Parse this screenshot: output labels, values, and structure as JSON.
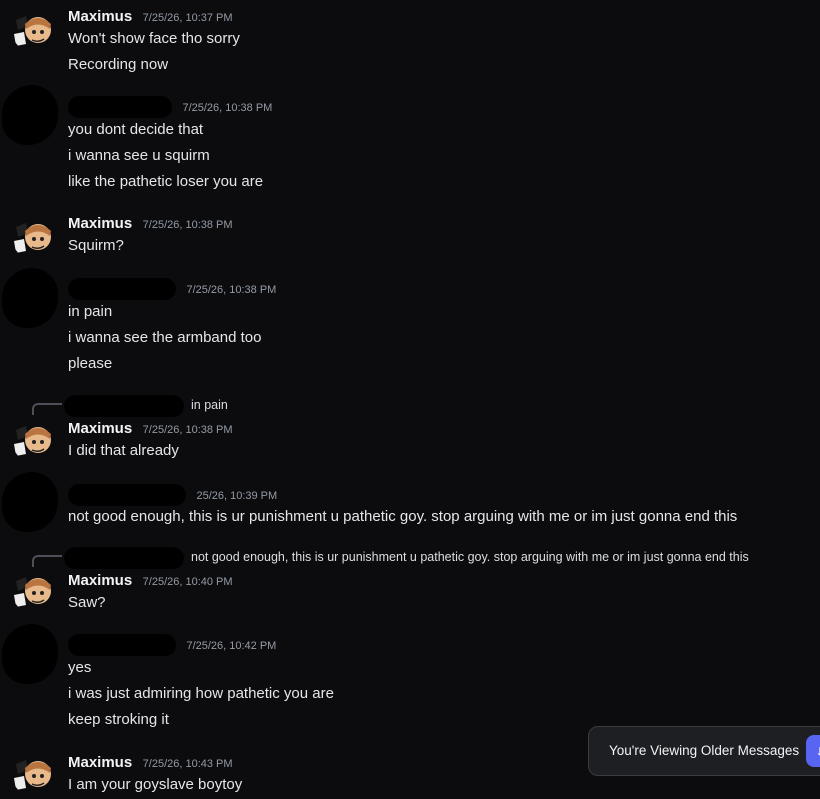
{
  "colors": {
    "background": "#0c0c0f",
    "timestamp": "#949ba4",
    "text": "#e6e6e9",
    "accent": "#5865f2"
  },
  "messages": [
    {
      "author": "Maximus",
      "timestamp": "7/25/26, 10:37 PM",
      "lines": [
        "Won't show face tho sorry",
        "Recording now"
      ]
    },
    {
      "author": "",
      "timestamp": "7/25/26, 10:38 PM",
      "lines": [
        "you dont decide that",
        "i wanna see u squirm",
        "like the pathetic loser you are"
      ]
    },
    {
      "author": "Maximus",
      "timestamp": "7/25/26, 10:38 PM",
      "lines": [
        "Squirm?"
      ]
    },
    {
      "author": "",
      "timestamp": "7/25/26, 10:38 PM",
      "lines": [
        "in pain",
        "i wanna see the armband too",
        "please"
      ]
    },
    {
      "author": "Maximus",
      "timestamp": "7/25/26, 10:38 PM",
      "reply_preview": "in pain",
      "lines": [
        "I did that already"
      ]
    },
    {
      "author": "",
      "timestamp": "25/26, 10:39 PM",
      "lines": [
        "not good enough, this is ur punishment u pathetic goy. stop arguing with me or im just gonna end this"
      ]
    },
    {
      "author": "Maximus",
      "timestamp": "7/25/26, 10:40 PM",
      "reply_preview": "not good enough, this is ur punishment u pathetic goy. stop arguing with me or im just gonna end this",
      "lines": [
        "Saw?"
      ]
    },
    {
      "author": "",
      "timestamp": "7/25/26, 10:42 PM",
      "lines": [
        "yes",
        "i was just admiring how pathetic you are",
        "keep stroking it"
      ]
    },
    {
      "author": "Maximus",
      "timestamp": "7/25/26, 10:43 PM",
      "lines": [
        "I am your goyslave boytoy"
      ]
    }
  ],
  "toast": {
    "text": "You're Viewing Older Messages"
  }
}
